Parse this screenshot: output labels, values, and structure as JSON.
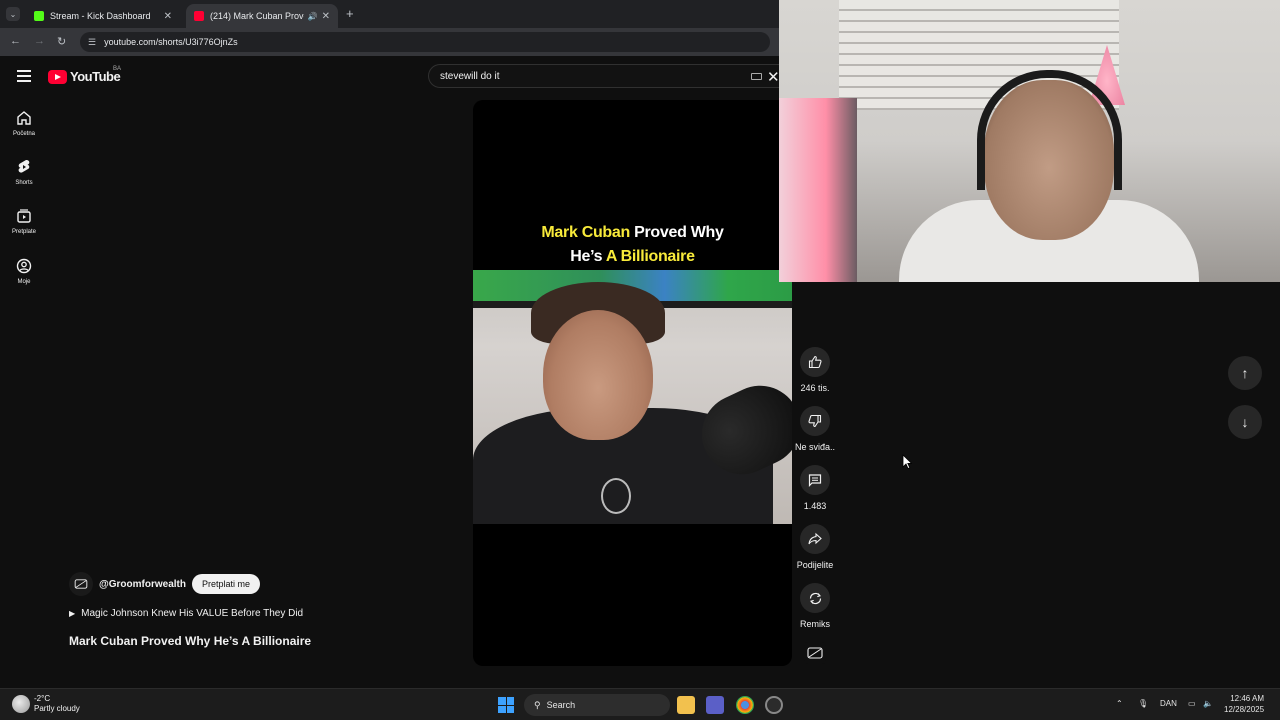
{
  "browser": {
    "tabs": [
      {
        "title": "Stream - Kick Dashboard",
        "favicon_color": "#53fc18",
        "active": false
      },
      {
        "title": "(214) Mark Cuban Proved W",
        "favicon_color": "#ff0033",
        "active": true
      }
    ],
    "url": "youtube.com/shorts/U3i776OjnZs"
  },
  "youtube": {
    "logo_text": "YouTube",
    "country_code": "BA",
    "search_value": "stevewill do it",
    "rail": [
      {
        "label": "Početna",
        "icon": "home-icon"
      },
      {
        "label": "Shorts",
        "icon": "shorts-icon"
      },
      {
        "label": "Pretplate",
        "icon": "subscriptions-icon"
      },
      {
        "label": "Moje",
        "icon": "you-icon"
      }
    ]
  },
  "short": {
    "caption_line1_highlight": "Mark Cuban",
    "caption_line1_rest": " Proved Why",
    "caption_line2_plain": "He’s ",
    "caption_line2_highlight": "A Billionaire",
    "channel": "@Groomforwealth",
    "subscribe_label": "Pretplati me",
    "related": "Magic Johnson Knew His VALUE Before They Did",
    "title": "Mark Cuban Proved Why He’s A Billionaire",
    "actions": {
      "like": "246 tis.",
      "dislike": "Ne sviđa..",
      "comments": "1.483",
      "share": "Podijelite",
      "remix": "Remiks"
    }
  },
  "taskbar": {
    "temperature": "-2°C",
    "weather": "Partly cloudy",
    "search_label": "Search",
    "language": "DAN",
    "time": "12:46 AM",
    "date": "12/28/2025"
  },
  "colors": {
    "youtube_red": "#ff0033",
    "caption_highlight": "#f8ea3a",
    "kick_green": "#53fc18"
  }
}
